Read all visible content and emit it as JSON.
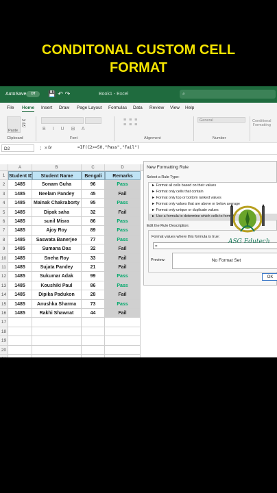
{
  "video_title": [
    "CONDITONAL CUSTOM CELL",
    "FORMAT"
  ],
  "titlebar": {
    "autosave": "AutoSave",
    "toggle": "Off",
    "filename": "Book1 - Excel"
  },
  "menu": [
    "File",
    "Home",
    "Insert",
    "Draw",
    "Page Layout",
    "Formulas",
    "Data",
    "Review",
    "View",
    "Help"
  ],
  "ribbon": {
    "paste": "Paste",
    "clipboard": "Clipboard",
    "font": "Font",
    "alignment": "Alignment",
    "number_format": "General",
    "number": "Number",
    "conditional": [
      "Conditional",
      "Formatting"
    ]
  },
  "formula_bar": {
    "cell_ref": "D2",
    "fx": "fx",
    "formula": "=IF(C2>=50,\"Pass\",\"Fail\")"
  },
  "columns": [
    "A",
    "B",
    "C",
    "D"
  ],
  "headers": [
    "Student ID",
    "Student Name",
    "Bengali",
    "Remarks"
  ],
  "rows": [
    [
      "1485",
      "Sonam Guha",
      "96",
      "Pass"
    ],
    [
      "1485",
      "Neelam Pandey",
      "45",
      "Fail"
    ],
    [
      "1485",
      "Mainak Chakraborty",
      "95",
      "Pass"
    ],
    [
      "1485",
      "Dipak saha",
      "32",
      "Fail"
    ],
    [
      "1485",
      "sunil Misra",
      "86",
      "Pass"
    ],
    [
      "1485",
      "Ajoy Roy",
      "89",
      "Pass"
    ],
    [
      "1485",
      "Saswata Banerjee",
      "77",
      "Pass"
    ],
    [
      "1485",
      "Sumana Das",
      "32",
      "Fail"
    ],
    [
      "1485",
      "Sneha Roy",
      "33",
      "Fail"
    ],
    [
      "1485",
      "Sujata Pandey",
      "21",
      "Fail"
    ],
    [
      "1485",
      "Sukumar Adak",
      "99",
      "Pass"
    ],
    [
      "1485",
      "Koushiki Paul",
      "86",
      "Pass"
    ],
    [
      "1485",
      "Dipika Padukon",
      "28",
      "Fail"
    ],
    [
      "1485",
      "Anushka Sharma",
      "73",
      "Pass"
    ],
    [
      "1485",
      "Rakhi Shawnat",
      "44",
      "Fail"
    ]
  ],
  "row_numbers": [
    "1",
    "2",
    "3",
    "4",
    "5",
    "6",
    "7",
    "8",
    "9",
    "10",
    "11",
    "12",
    "13",
    "14",
    "15",
    "16",
    "17",
    "18",
    "19",
    "20",
    "21",
    "22"
  ],
  "dialog": {
    "title": "New Formatting Rule",
    "select_label": "Select a Rule Type:",
    "rule_types": [
      "► Format all cells based on their values",
      "► Format only cells that contain",
      "► Format only top or bottom ranked values",
      "► Format only values that are above or below average",
      "► Format only unique or duplicate values",
      "► Use a formula to determine which cells to format"
    ],
    "edit_label": "Edit the Rule Description:",
    "formula_label": "Format values where this formula is true:",
    "formula_value": "=",
    "preview_label": "Preview:",
    "preview_text": "No Format Set",
    "ok": "OK"
  },
  "logo_text": "ASG Edutech",
  "colors": {
    "title": "#f5e400",
    "excel_green": "#1f6b3e",
    "pass": "#00a86b",
    "header_fill": "#bfe3f5"
  }
}
